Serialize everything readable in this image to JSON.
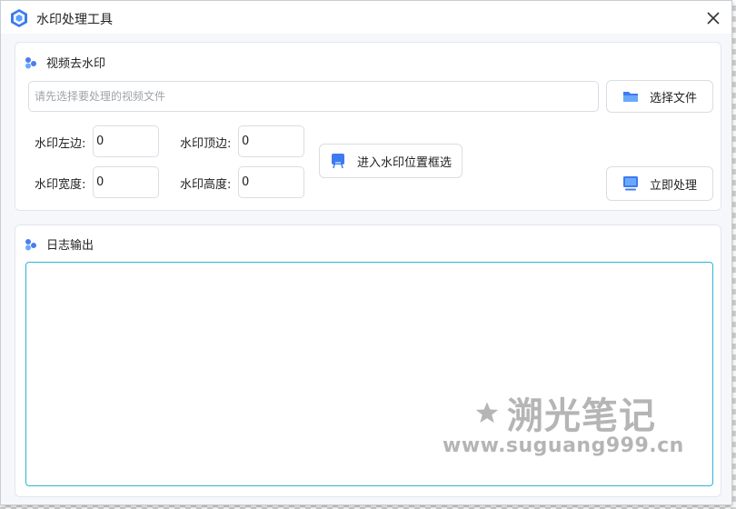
{
  "window": {
    "title": "水印处理工具",
    "logo_icon": "app-logo-icon",
    "close_icon": "close-icon"
  },
  "video_section": {
    "title": "视频去水印",
    "file_path": {
      "value": "",
      "placeholder": "请先选择要处理的视频文件"
    },
    "select_button": {
      "label": "选择文件",
      "icon": "folder-icon"
    },
    "fields": {
      "left": {
        "label": "水印左边:",
        "value": "0"
      },
      "top": {
        "label": "水印顶边:",
        "value": "0"
      },
      "width": {
        "label": "水印宽度:",
        "value": "0"
      },
      "height": {
        "label": "水印高度:",
        "value": "0"
      }
    },
    "region_button": {
      "label": "进入水印位置框选",
      "icon": "select-region-icon"
    },
    "process_button": {
      "label": "立即处理",
      "icon": "monitor-icon"
    }
  },
  "log_section": {
    "title": "日志输出",
    "content": ""
  },
  "watermark": {
    "title": "溯光笔记",
    "url": "www.suguang999.cn"
  },
  "colors": {
    "accent": "#3d7bf0",
    "log_border": "#2bb5d8",
    "panel_border": "#e1e6ee",
    "watermark": "#b5b5b5"
  }
}
